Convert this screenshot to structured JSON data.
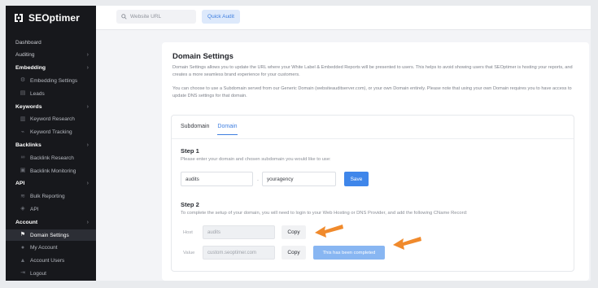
{
  "app": {
    "logo_text": "SEOptimer"
  },
  "topbar": {
    "url_placeholder": "Website URL",
    "quick_audit_label": "Quick Audit"
  },
  "sidebar": {
    "items": [
      {
        "label": "Dashboard",
        "type": "plain"
      },
      {
        "label": "Auditing",
        "type": "plain",
        "chevron": "›"
      },
      {
        "label": "Embedding",
        "type": "bold",
        "chevron": "›"
      },
      {
        "label": "Embedding Settings",
        "type": "sub",
        "icon": "gear-icon"
      },
      {
        "label": "Leads",
        "type": "sub",
        "icon": "leads-icon"
      },
      {
        "label": "Keywords",
        "type": "bold",
        "chevron": "›"
      },
      {
        "label": "Keyword Research",
        "type": "sub",
        "icon": "bars-icon"
      },
      {
        "label": "Keyword Tracking",
        "type": "sub",
        "icon": "tracking-icon"
      },
      {
        "label": "Backlinks",
        "type": "bold",
        "chevron": "›"
      },
      {
        "label": "Backlink Research",
        "type": "sub",
        "icon": "link-icon"
      },
      {
        "label": "Backlink Monitoring",
        "type": "sub",
        "icon": "monitor-icon"
      },
      {
        "label": "API",
        "type": "bold",
        "chevron": "›"
      },
      {
        "label": "Bulk Reporting",
        "type": "sub",
        "icon": "reporting-icon"
      },
      {
        "label": "API",
        "type": "sub",
        "icon": "api-icon"
      },
      {
        "label": "Account",
        "type": "bold",
        "chevron": "›"
      },
      {
        "label": "Domain Settings",
        "type": "sub",
        "icon": "domain-icon",
        "active": true
      },
      {
        "label": "My Account",
        "type": "sub",
        "icon": "user-icon"
      },
      {
        "label": "Account Users",
        "type": "sub",
        "icon": "users-icon"
      },
      {
        "label": "Logout",
        "type": "sub",
        "icon": "logout-icon"
      }
    ]
  },
  "main": {
    "title": "Domain Settings",
    "desc1": "Domain Settings allows you to update the URL where your White Label & Embedded Reports will be presented to users. This helps to avoid showing users that SEOptimer is hosting your reports, and creates a more seamless brand experience for your customers.",
    "desc2": "You can choose to use a Subdomain served from our Generic Domain (websiteauditserver.com), or your own Domain entirely. Please note that using your own Domain requires you to have access to update DNS settings for that domain.",
    "tabs": [
      {
        "label": "Subdomain",
        "active": false
      },
      {
        "label": "Domain",
        "active": true
      }
    ],
    "step1": {
      "title": "Step 1",
      "desc": "Please enter your domain and chosen subdomain you would like to use:",
      "subdomain_value": "audits",
      "separator": ".",
      "domain_value": "youragency",
      "save_label": "Save"
    },
    "step2": {
      "title": "Step 2",
      "desc": "To complete the setup of your domain, you will need to login to your Web Hosting or DNS Provider, and add the following CName Record:",
      "host_label": "Host",
      "host_value": "audits",
      "value_label": "Value",
      "value_value": "custom.seoptimer.com",
      "copy_label": "Copy",
      "completed_label": "This has been completed"
    }
  },
  "colors": {
    "accent": "#3f86ea",
    "arrow": "#f08a2c",
    "sidebar_bg": "#17181c"
  }
}
